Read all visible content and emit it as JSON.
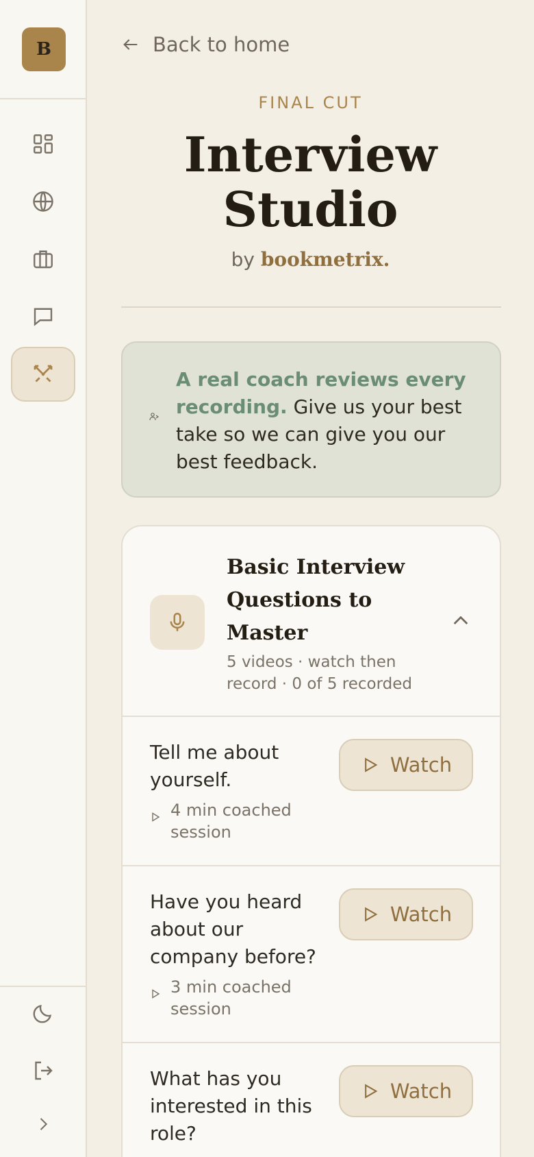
{
  "brand": {
    "logo_letter": "B",
    "accent": "#a9844b"
  },
  "sidebar": {
    "items": [
      {
        "icon": "dashboard-icon",
        "active": false
      },
      {
        "icon": "globe-icon",
        "active": false
      },
      {
        "icon": "briefcase-icon",
        "active": false
      },
      {
        "icon": "chat-icon",
        "active": false
      },
      {
        "icon": "crossed-swords-icon",
        "active": true
      }
    ],
    "bottom": [
      {
        "icon": "moon-icon"
      },
      {
        "icon": "logout-icon"
      },
      {
        "icon": "chevron-right-icon"
      }
    ]
  },
  "header": {
    "back_label": "Back to home",
    "eyebrow": "FINAL CUT",
    "title_line1": "Interview",
    "title_line2": "Studio",
    "by": "by",
    "by_brand": "bookmetrix."
  },
  "coach_note": {
    "highlight": "A real coach reviews every recording.",
    "text": " Give us your best take so we can give you our best feedback."
  },
  "section": {
    "title": "Basic Interview Questions to Master",
    "subtitle": "5 videos · watch then record · 0 of 5 recorded",
    "questions": [
      {
        "text": "Tell me about yourself.",
        "meta": "4 min coached session",
        "action": "Watch"
      },
      {
        "text": "Have you heard about our company before?",
        "meta": "3 min coached session",
        "action": "Watch"
      },
      {
        "text": "What has you interested in this role?",
        "meta": "",
        "action": "Watch"
      }
    ]
  }
}
